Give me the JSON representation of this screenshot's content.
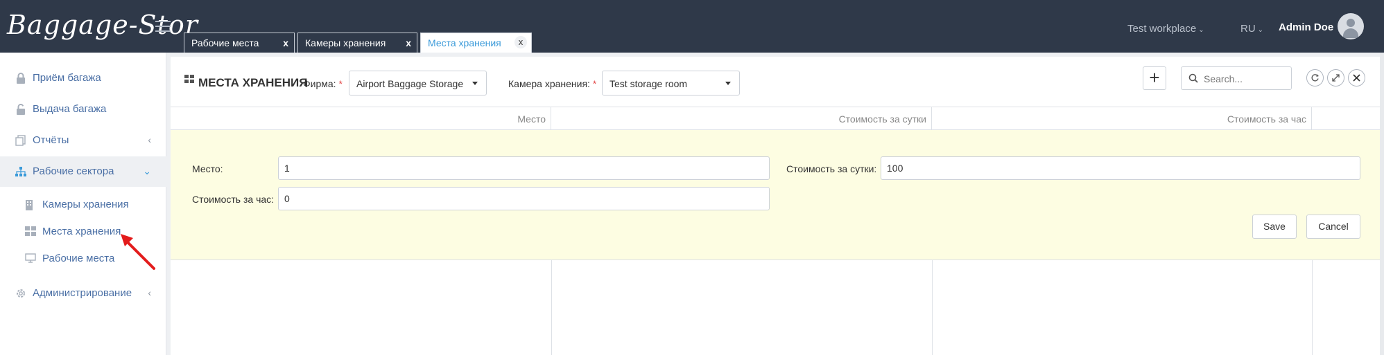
{
  "app": {
    "logo": "Baggage-Stor"
  },
  "tabs": [
    {
      "label": "Рабочие места",
      "close": "x"
    },
    {
      "label": "Камеры хранения",
      "close": "x"
    },
    {
      "label": "Места хранения",
      "close": "x",
      "active": true
    }
  ],
  "header": {
    "workplace": "Test workplace",
    "language": "RU",
    "user": "Admin Doe"
  },
  "sidebar": {
    "items": [
      {
        "label": "Приём багажа",
        "icon": "lock-icon"
      },
      {
        "label": "Выдача багажа",
        "icon": "unlock-icon"
      },
      {
        "label": "Отчёты",
        "icon": "copy-icon",
        "arrow": "‹"
      },
      {
        "label": "Рабочие сектора",
        "icon": "sitemap-icon",
        "arrow": "⌄",
        "open": true
      },
      {
        "label": "Администрирование",
        "icon": "gear-icon",
        "arrow": "‹"
      }
    ],
    "subitems": [
      {
        "label": "Камеры хранения",
        "icon": "building-icon"
      },
      {
        "label": "Места хранения",
        "icon": "grid-icon"
      },
      {
        "label": "Рабочие места",
        "icon": "monitor-icon"
      }
    ]
  },
  "page": {
    "title": "МЕСТА ХРАНЕНИЯ",
    "firm_label": "Фирма:",
    "firm_value": "Airport Baggage Storage",
    "room_label": "Камера хранения:",
    "room_value": "Test storage room",
    "required_mark": "*",
    "add_label": "+",
    "search_placeholder": "Search..."
  },
  "table": {
    "columns": [
      "Место",
      "Стоимость за сутки",
      "Стоимость за час"
    ]
  },
  "form": {
    "place_label": "Место:",
    "place_value": "1",
    "day_price_label": "Стоимость за сутки:",
    "day_price_value": "100",
    "hour_price_label": "Стоимость за час:",
    "hour_price_value": "0",
    "save_label": "Save",
    "cancel_label": "Cancel"
  },
  "colors": {
    "topbar": "#2f3949",
    "accent": "#3a9ad9",
    "form_bg": "#fdfde2",
    "required": "#e34a4a",
    "annotation_arrow": "#e31b1b"
  }
}
